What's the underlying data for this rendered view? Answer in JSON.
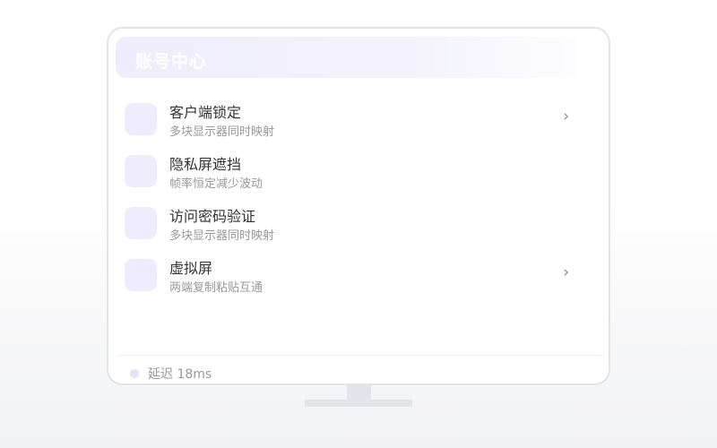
{
  "header": {
    "title": "账号中心"
  },
  "items": [
    {
      "title": "客户端锁定",
      "subtitle": "多块显示器同时映射",
      "chevron": "›",
      "icon": "lock-icon"
    },
    {
      "title": "隐私屏遮挡",
      "subtitle": "帧率恒定减少波动",
      "icon": "privacy-icon"
    },
    {
      "title": "访问密码验证",
      "subtitle": "多块显示器同时映射",
      "icon": "password-icon"
    },
    {
      "title": "虚拟屏",
      "subtitle": "两端复制粘贴互通",
      "chevron": "›",
      "icon": "virtual-screen-icon"
    }
  ],
  "status": {
    "text": "延迟 18ms"
  },
  "colors": {
    "accent_light": "#efedfd",
    "text_primary": "#333333",
    "text_secondary": "#999999",
    "frame": "#e3e4e8"
  }
}
